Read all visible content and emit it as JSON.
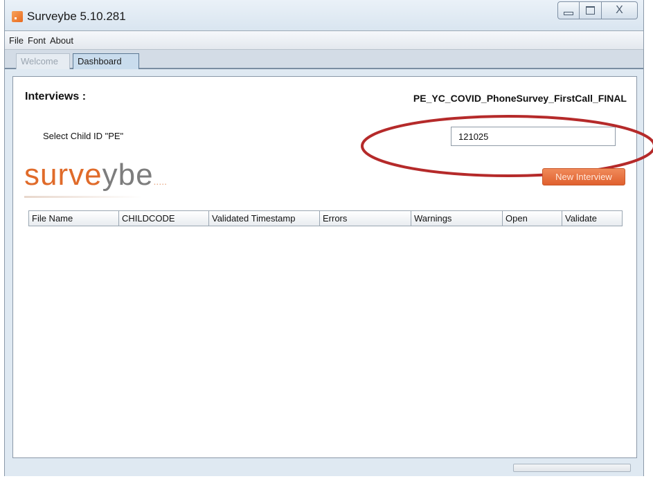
{
  "window": {
    "title": "Surveybe 5.10.281",
    "close_glyph": "X"
  },
  "menu": {
    "items": [
      "File",
      "Font",
      "About"
    ]
  },
  "tabs": [
    {
      "label": "Welcome",
      "active": false
    },
    {
      "label": "Dashboard",
      "active": true
    }
  ],
  "dashboard": {
    "interviews_label": "Interviews :",
    "survey_name": "PE_YC_COVID_PhoneSurvey_FirstCall_FINAL",
    "child_id_label": "Select Child ID \"PE\"",
    "child_id_value": "121025",
    "logo": {
      "part1": "surve",
      "part2": "ybe",
      "dots": "....."
    },
    "new_interview_label": "New Interview",
    "table": {
      "columns": [
        "File Name",
        "CHILDCODE",
        "Validated Timestamp",
        "Errors",
        "Warnings",
        "Open",
        "Validate"
      ],
      "rows": []
    }
  },
  "status": {
    "progress": 0
  },
  "colors": {
    "accent": "#e06b2a",
    "highlight": "#b52a2a"
  }
}
